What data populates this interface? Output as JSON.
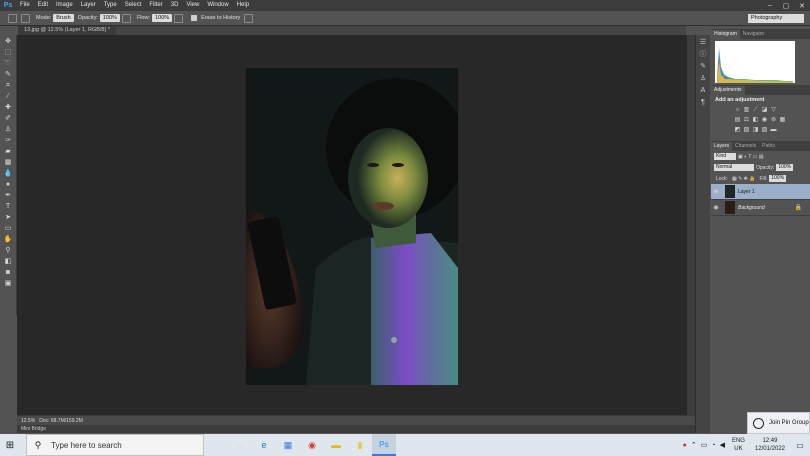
{
  "app": {
    "logo": "Ps"
  },
  "menu": [
    "File",
    "Edit",
    "Image",
    "Layer",
    "Type",
    "Select",
    "Filter",
    "3D",
    "View",
    "Window",
    "Help"
  ],
  "window_controls": [
    "–",
    "▢",
    "✕"
  ],
  "options": {
    "mode_label": "Mode:",
    "mode_value": "Brush",
    "opacity_label": "Opacity:",
    "opacity_value": "100%",
    "flow_label": "Flow:",
    "flow_value": "100%",
    "erase_label": "Erase to History",
    "workspace": "Photography"
  },
  "document": {
    "tab_title": "13.jpg @ 12.5% (Layer 1, RGB/8) *"
  },
  "status": {
    "zoom": "12.5%",
    "doc": "Doc: 68.7M/159.2M"
  },
  "minibridge": {
    "label": "Mini Bridge"
  },
  "panels": {
    "histogram_tabs": [
      "Histogram",
      "Navigator"
    ],
    "adjustments_tabs": [
      "Adjustments"
    ],
    "adjustments_title": "Add an adjustment",
    "layers_tabs": [
      "Layers",
      "Channels",
      "Paths"
    ],
    "kind_label": "Kind",
    "blend_mode": "Normal",
    "opacity_label": "Opacity:",
    "opacity_value": "100%",
    "lock_label": "Lock:",
    "fill_label": "Fill:",
    "fill_value": "100%",
    "layers": [
      {
        "name": "Layer 1",
        "selected": true
      },
      {
        "name": "Background",
        "selected": false
      }
    ]
  },
  "pin_popup": {
    "label": "Join Pin Group"
  },
  "taskbar": {
    "search_placeholder": "Type here to search",
    "lang_top": "ENG",
    "lang_bottom": "UK",
    "time": "12:49",
    "date": "12/01/2022"
  },
  "colors": {
    "ps_blue": "#4aa3f0",
    "canvas_bg": "#282828",
    "panel_bg": "#535353",
    "layer_selected": "#9ab0c9"
  }
}
